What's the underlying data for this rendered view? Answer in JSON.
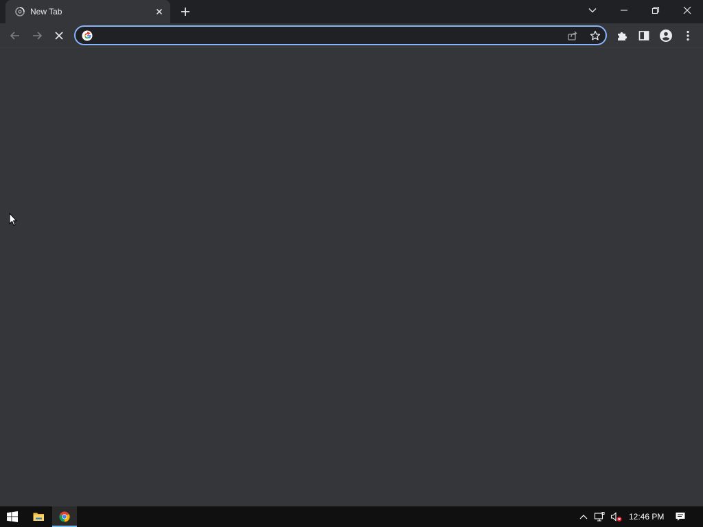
{
  "browser": {
    "tab": {
      "title": "New Tab",
      "favicon": "loading-spinner-icon",
      "close_icon": "close-icon"
    },
    "new_tab_icon": "plus-icon",
    "window_controls": [
      "tab-search-icon",
      "minimize-icon",
      "restore-icon",
      "close-icon"
    ],
    "nav": [
      "back-arrow-icon",
      "forward-arrow-icon",
      "stop-loading-icon"
    ],
    "omnibox": {
      "value": "",
      "placeholder": "",
      "engine_icon": "google-g-icon"
    },
    "toolbar_icons": [
      "share-icon",
      "bookmark-star-icon",
      "extensions-icon",
      "side-panel-icon",
      "profile-icon",
      "menu-kebab-icon"
    ]
  },
  "taskbar": {
    "pinned": [
      "windows-start-icon",
      "file-explorer-icon",
      "chrome-icon"
    ],
    "active": "chrome-icon",
    "tray": [
      "show-hidden-icons-chevron",
      "network-icon",
      "volume-muted-icon",
      "notification-center-icon"
    ],
    "clock": "12:46 PM"
  },
  "colors": {
    "titlebar": "#202124",
    "toolbar": "#35363a",
    "omnibox_bg": "#202124",
    "omnibox_border": "#8ab4f8",
    "content": "#35363a",
    "taskbar": "#101010",
    "taskbar_active_accent": "#76b9ed"
  }
}
